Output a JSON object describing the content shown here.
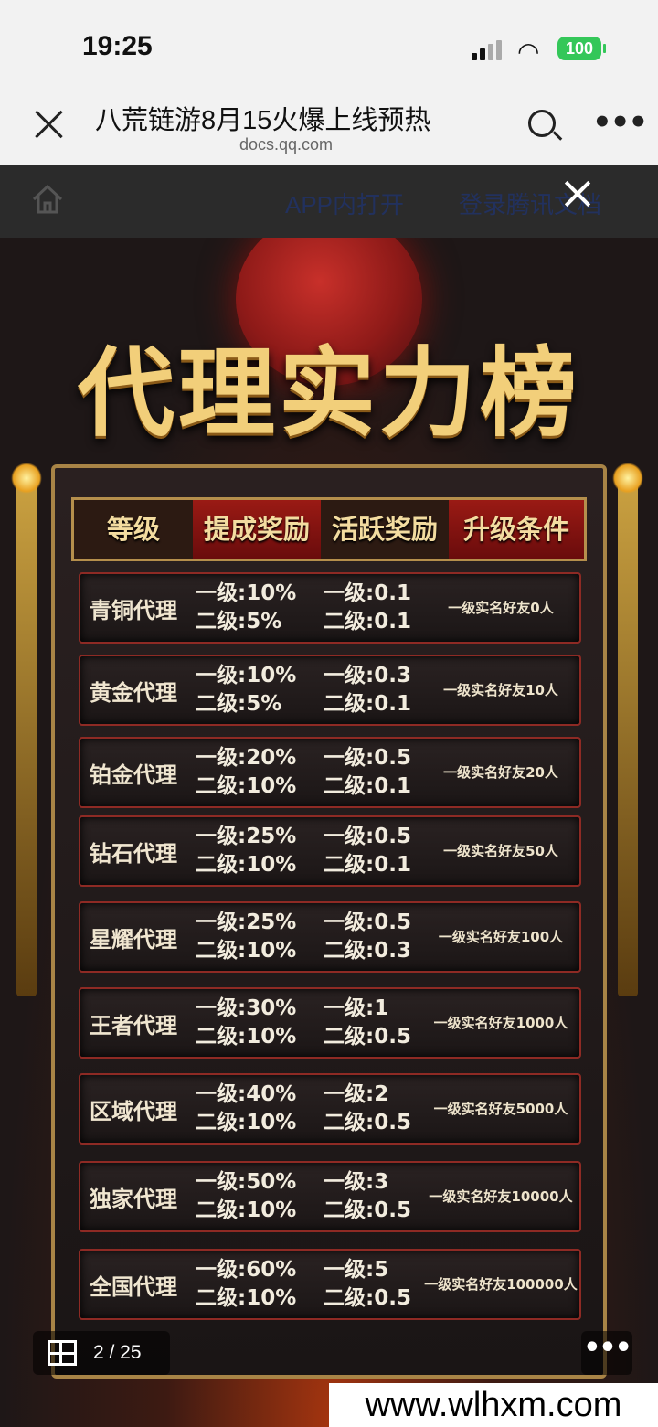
{
  "status_bar": {
    "time": "19:25",
    "battery": "100"
  },
  "nav": {
    "title": "八荒链游8月15火爆上线预热",
    "subtitle": "docs.qq.com"
  },
  "toolbar": {
    "open_in_app": "APP内打开",
    "login": "登录腾讯文档"
  },
  "poster": {
    "title": "代理实力榜",
    "headers": [
      "等级",
      "提成奖励",
      "活跃奖励",
      "升级条件"
    ],
    "rows": [
      {
        "name": "青铜代理",
        "c1a": "一级:10%",
        "c1b": "二级:5%",
        "c2a": "一级:0.1",
        "c2b": "二级:0.1",
        "cond": "一级实名好友0人"
      },
      {
        "name": "黄金代理",
        "c1a": "一级:10%",
        "c1b": "二级:5%",
        "c2a": "一级:0.3",
        "c2b": "二级:0.1",
        "cond": "一级实名好友10人"
      },
      {
        "name": "铂金代理",
        "c1a": "一级:20%",
        "c1b": "二级:10%",
        "c2a": "一级:0.5",
        "c2b": "二级:0.1",
        "cond": "一级实名好友20人"
      },
      {
        "name": "钻石代理",
        "c1a": "一级:25%",
        "c1b": "二级:10%",
        "c2a": "一级:0.5",
        "c2b": "二级:0.1",
        "cond": "一级实名好友50人"
      },
      {
        "name": "星耀代理",
        "c1a": "一级:25%",
        "c1b": "二级:10%",
        "c2a": "一级:0.5",
        "c2b": "二级:0.3",
        "cond": "一级实名好友100人"
      },
      {
        "name": "王者代理",
        "c1a": "一级:30%",
        "c1b": "二级:10%",
        "c2a": "一级:1",
        "c2b": "二级:0.5",
        "cond": "一级实名好友1000人"
      },
      {
        "name": "区域代理",
        "c1a": "一级:40%",
        "c1b": "二级:10%",
        "c2a": "一级:2",
        "c2b": "二级:0.5",
        "cond": "一级实名好友5000人"
      },
      {
        "name": "独家代理",
        "c1a": "一级:50%",
        "c1b": "二级:10%",
        "c2a": "一级:3",
        "c2b": "二级:0.5",
        "cond": "一级实名好友10000人"
      },
      {
        "name": "全国代理",
        "c1a": "一级:60%",
        "c1b": "二级:10%",
        "c2a": "一级:5",
        "c2b": "二级:0.5",
        "cond": "一级实名好友100000人"
      }
    ]
  },
  "pager": {
    "text": "2 / 25"
  },
  "watermark": "www.wlhxm.com",
  "colors": {
    "gold": "#f2cf7a",
    "row_border": "#8e2a24",
    "header_red": "#9a1a14"
  }
}
